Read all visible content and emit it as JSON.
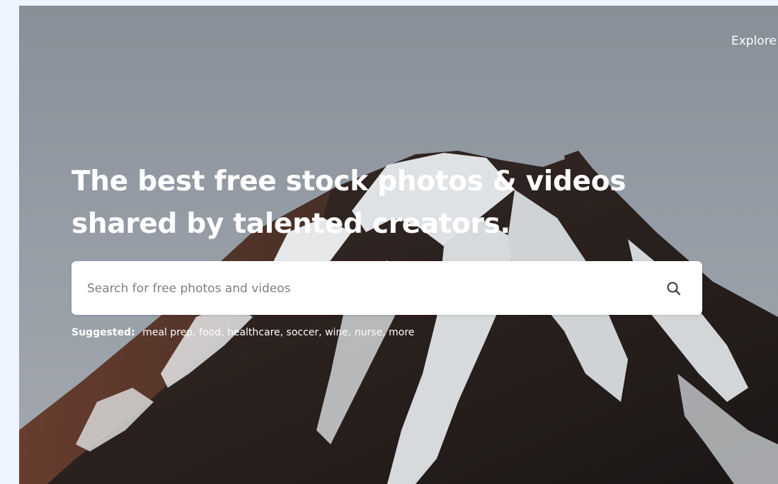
{
  "nav": {
    "explore_label": "Explore"
  },
  "hero": {
    "title_line1": "The best free stock photos & videos",
    "title_line2": "shared by talented creators.",
    "background": "snow-capped-mountain-photo"
  },
  "search": {
    "placeholder": "Search for free photos and videos",
    "value": "",
    "icon": "search-icon"
  },
  "suggested": {
    "label": "Suggested:",
    "items": [
      "meal prep",
      "food",
      "healthcare",
      "soccer",
      "wine",
      "nurse",
      "more"
    ]
  },
  "colors": {
    "page_background": "#eef4fd",
    "sky": "#8f969f",
    "search_background": "#ffffff",
    "text_on_hero": "#ffffff"
  }
}
